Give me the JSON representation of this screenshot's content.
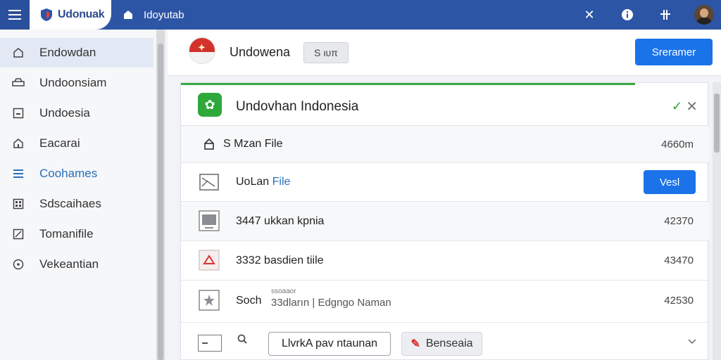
{
  "topbar": {
    "app_title": "Udonuak",
    "tab2_title": "Idoyutab",
    "icons": [
      "close-icon",
      "info-icon",
      "grid-plus-icon",
      "avatar"
    ]
  },
  "sidebar": {
    "items": [
      {
        "label": "Endowdan",
        "icon": "home-icon"
      },
      {
        "label": "Undoonsiam",
        "icon": "car-icon"
      },
      {
        "label": "Undoesia",
        "icon": "layout-icon"
      },
      {
        "label": "Eacarai",
        "icon": "house-icon"
      },
      {
        "label": "Coohames",
        "icon": "list-icon"
      },
      {
        "label": "Sdscaihaes",
        "icon": "grid-icon"
      },
      {
        "label": "Tomanifile",
        "icon": "edit-box-icon"
      },
      {
        "label": "Vekeantian",
        "icon": "circle-icon"
      }
    ],
    "active_index": 0,
    "highlight_index": 4
  },
  "header": {
    "title": "Undowena",
    "chip": "S ιυπ",
    "primary_button": "Sreramer"
  },
  "card": {
    "title": "Undovhan Indonesia",
    "progress_percent": 86,
    "rows": [
      {
        "name": "S Mzan File",
        "size": "4660m",
        "icon": "upload-icon"
      },
      {
        "name_a": "UoLan",
        "name_b": "File",
        "button": "Vesl",
        "icon": "image-icon"
      },
      {
        "name": "3447 ukkan kpnia",
        "size": "42370",
        "icon": "monitor-icon"
      },
      {
        "name": "3332 basdien tiile",
        "size": "43470",
        "icon": "pdf-icon"
      },
      {
        "name": "Soch",
        "note": "ssoaaor",
        "subline": "33dların | Edgngo Naman",
        "size": "42530",
        "icon": "star-icon"
      }
    ],
    "bottom": {
      "outline_button": "LlvrkΑ pav ntaunan",
      "ghost_button": "Benseaia"
    }
  },
  "colors": {
    "topbar": "#2d55a6",
    "primary": "#1a73e8",
    "green": "#2ea83a"
  }
}
